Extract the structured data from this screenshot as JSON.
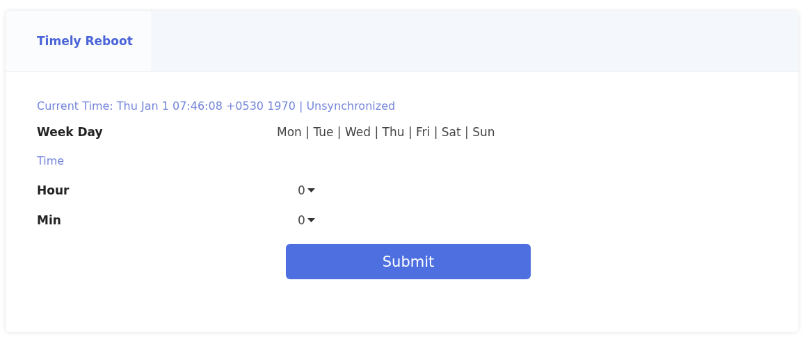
{
  "tabs": [
    {
      "label": "Timely Reboot",
      "selected": true
    }
  ],
  "current_time": "Current Time: Thu Jan 1 07:46:08 +0530 1970 | Unsynchronized",
  "week_day": {
    "label": "Week Day",
    "value": "Mon | Tue | Wed | Thu | Fri | Sat | Sun"
  },
  "time_section": "Time",
  "fields": [
    {
      "label": "Hour",
      "value": "0"
    },
    {
      "label": "Min",
      "value": "0"
    }
  ],
  "submit_button": "Submit"
}
